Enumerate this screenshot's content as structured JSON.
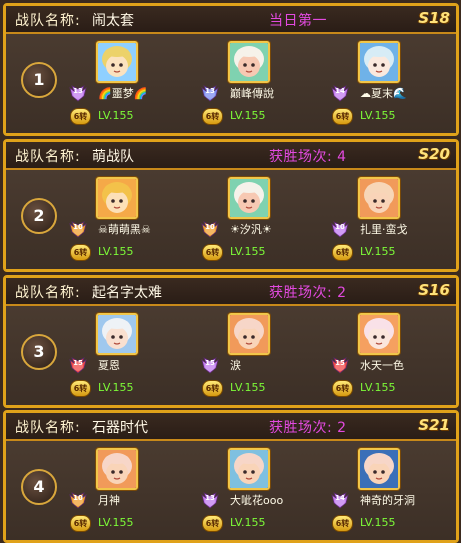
{
  "teams": [
    {
      "rank": "1",
      "label": "战队名称:",
      "name": "闹太套",
      "status": "当日第一",
      "season": "S18",
      "members": [
        {
          "name": "🌈噩梦🌈",
          "level_badge": "13",
          "turn": "6转",
          "level": "LV.155",
          "hair": "#ecd26a",
          "skin": "#fbe2bf",
          "bg": "#8fd0ff",
          "badge_color": "#c27cf0"
        },
        {
          "name": "巅峰傳說",
          "level_badge": "13",
          "turn": "6转",
          "level": "LV.155",
          "hair": "#f6f2ea",
          "skin": "#f7c9b3",
          "bg": "#7fd2b0",
          "badge_color": "#7c8cf0"
        },
        {
          "name": "☁夏末🌊",
          "level_badge": "14",
          "turn": "6转",
          "level": "LV.155",
          "hair": "#d7ecf6",
          "skin": "#fbe9de",
          "bg": "#6fb2e8",
          "badge_color": "#c27cf0"
        }
      ]
    },
    {
      "rank": "2",
      "label": "战队名称:",
      "name": "萌战队",
      "status": "获胜场次: 4",
      "season": "S20",
      "members": [
        {
          "name": "☠萌萌黑☠",
          "level_badge": "10",
          "turn": "6转",
          "level": "LV.155",
          "hair": "#f3c24a",
          "skin": "#fce0b8",
          "bg": "#f5a948",
          "badge_color": "#f0a030"
        },
        {
          "name": "☀汐汎☀",
          "level_badge": "10",
          "turn": "6转",
          "level": "LV.155",
          "hair": "#f6f2ea",
          "skin": "#f7c9b3",
          "bg": "#7fd2b0",
          "badge_color": "#f0a030"
        },
        {
          "name": "扎里·蛮戈",
          "level_badge": "10",
          "turn": "6转",
          "level": "LV.155",
          "hair": "#f7d6b8",
          "skin": "#f9d4b8",
          "bg": "#f19a5a",
          "badge_color": "#c27cf0"
        }
      ]
    },
    {
      "rank": "3",
      "label": "战队名称:",
      "name": "起名字太难",
      "status": "获胜场次: 2",
      "season": "S16",
      "members": [
        {
          "name": "夏恩",
          "level_badge": "15",
          "turn": "6转",
          "level": "LV.155",
          "hair": "#eef2f6",
          "skin": "#f9e0d0",
          "bg": "#9fc8ee",
          "badge_color": "#f04848"
        },
        {
          "name": "涙",
          "level_badge": "15",
          "turn": "6转",
          "level": "LV.155",
          "hair": "#f7d6c8",
          "skin": "#f9d4b8",
          "bg": "#f19a5a",
          "badge_color": "#c27cf0"
        },
        {
          "name": "水天一色",
          "level_badge": "15",
          "turn": "6转",
          "level": "LV.155",
          "hair": "#f9e1e8",
          "skin": "#fbe6dc",
          "bg": "#f5a060",
          "badge_color": "#f04848"
        }
      ]
    },
    {
      "rank": "4",
      "label": "战队名称:",
      "name": "石器时代",
      "status": "获胜场次: 2",
      "season": "S21",
      "members": [
        {
          "name": "月神",
          "level_badge": "10",
          "turn": "6转",
          "level": "LV.155",
          "hair": "#f7d6c8",
          "skin": "#f9d4b8",
          "bg": "#f19a5a",
          "badge_color": "#f0a030"
        },
        {
          "name": "大呲花ooo",
          "level_badge": "13",
          "turn": "6转",
          "level": "LV.155",
          "hair": "#f7d6c8",
          "skin": "#f9d4b8",
          "bg": "#7fc0e0",
          "badge_color": "#c27cf0"
        },
        {
          "name": "神奇的牙洞",
          "level_badge": "14",
          "turn": "6转",
          "level": "LV.155",
          "hair": "#f7d6c8",
          "skin": "#f9d4b8",
          "bg": "#3a6fb8",
          "badge_color": "#c27cf0"
        }
      ]
    }
  ]
}
